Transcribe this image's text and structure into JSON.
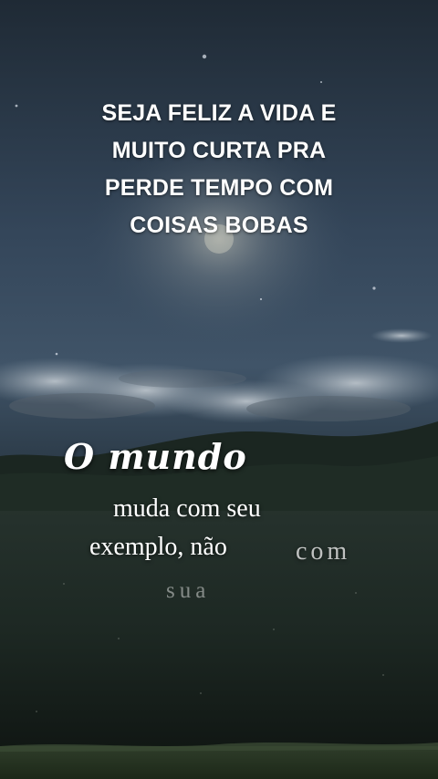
{
  "caption": {
    "lines": [
      "SEJA FELIZ A VIDA E",
      "MUITO CURTA PRA",
      "PERDE TEMPO COM",
      "COISAS BOBAS"
    ]
  },
  "overlay": {
    "headline": "O mundo",
    "line1": "muda com seu",
    "line2": "exemplo, não",
    "fading_word_1": "com",
    "fading_word_2": "sua"
  },
  "colors": {
    "sky_top": "#22303d",
    "sky_mid": "#3a4e61",
    "ground": "#1f2a22",
    "text": "#ffffff"
  }
}
